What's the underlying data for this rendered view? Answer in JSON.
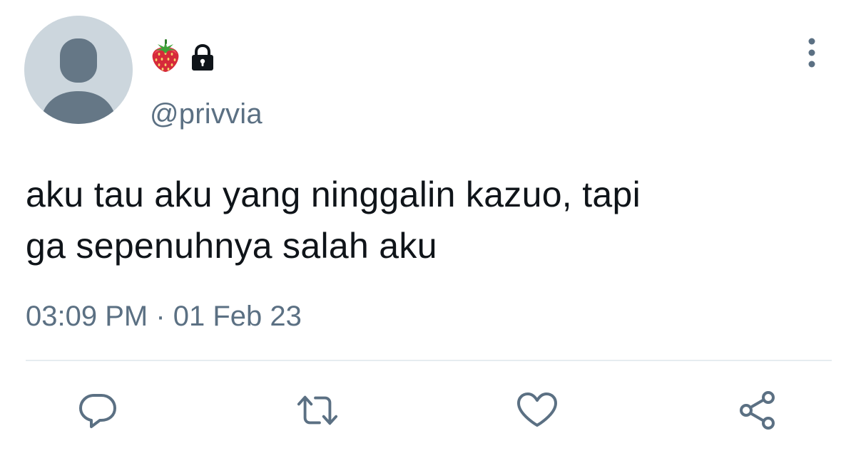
{
  "user": {
    "avatar_icon": "default-avatar-icon",
    "name_emoji": "strawberry-icon",
    "protected_icon": "lock-icon",
    "handle": "@privvia"
  },
  "tweet": {
    "text_line1": "aku tau aku yang ninggalin kazuo, tapi",
    "text_line2": "ga sepenuhnya salah aku",
    "timestamp": "03:09 PM · 01 Feb 23"
  },
  "actions": [
    {
      "icon": "reply-icon"
    },
    {
      "icon": "retweet-icon"
    },
    {
      "icon": "like-icon"
    },
    {
      "icon": "share-icon"
    }
  ],
  "menu": {
    "icon": "more-vertical-icon"
  },
  "colors": {
    "text_primary": "#0f1419",
    "text_secondary": "#5b7083",
    "avatar_bg": "#ccd6dd",
    "avatar_fg": "#657786",
    "divider": "#e6ecf0"
  }
}
